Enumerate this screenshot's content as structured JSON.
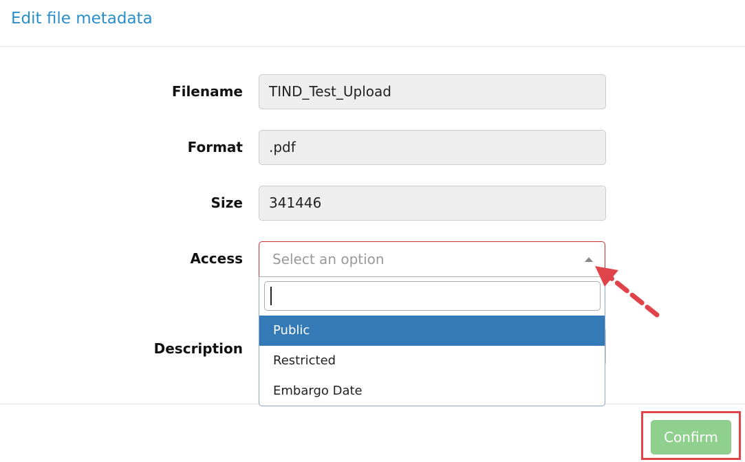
{
  "modal": {
    "title": "Edit file metadata"
  },
  "form": {
    "filename": {
      "label": "Filename",
      "value": "TIND_Test_Upload"
    },
    "format": {
      "label": "Format",
      "value": ".pdf"
    },
    "size": {
      "label": "Size",
      "value": "341446"
    },
    "access": {
      "label": "Access",
      "placeholder": "Select an option",
      "options": [
        "Public",
        "Restricted",
        "Embargo Date"
      ],
      "highlighted_index": 0
    },
    "description": {
      "label": "Description"
    }
  },
  "footer": {
    "confirm_label": "Confirm"
  },
  "colors": {
    "title": "#2a8fc9",
    "highlight_option": "#337ab7",
    "confirm_button": "#8fd08f",
    "annotation": "#e0444b"
  }
}
